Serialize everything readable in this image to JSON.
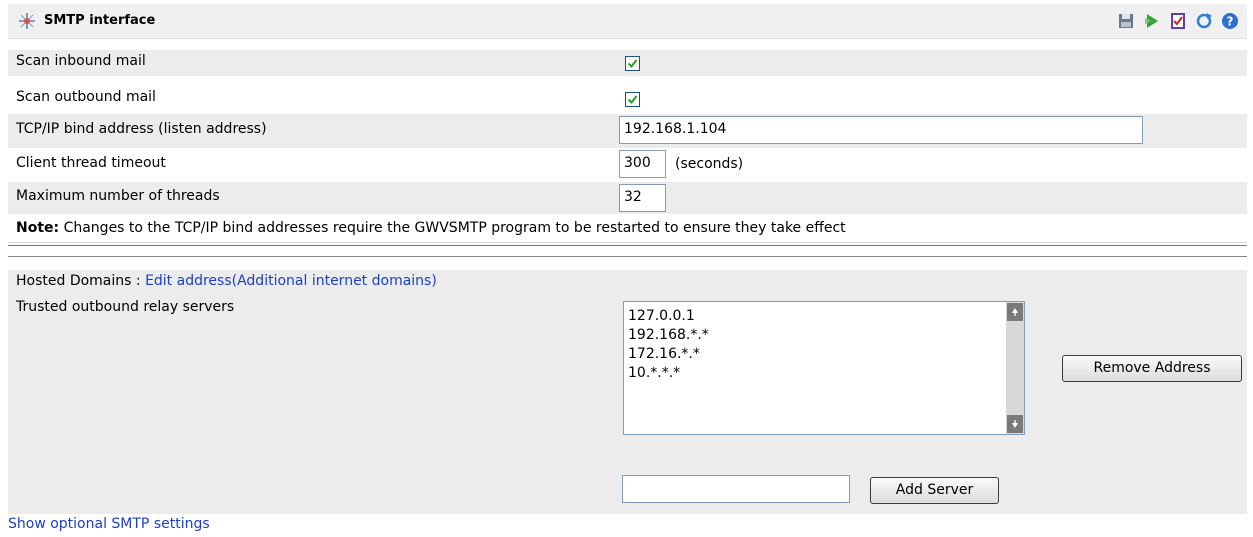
{
  "panel": {
    "title": "SMTP interface",
    "toolbar_icons": [
      "save-icon",
      "run-icon",
      "checklist-icon",
      "refresh-icon",
      "help-icon"
    ]
  },
  "settings": {
    "scan_inbound_label": "Scan inbound mail",
    "scan_inbound_checked": true,
    "scan_outbound_label": "Scan outbound mail",
    "scan_outbound_checked": true,
    "bind_address_label": "TCP/IP bind address (listen address)",
    "bind_address_value": "192.168.1.104",
    "thread_timeout_label": "Client thread timeout",
    "thread_timeout_value": "300",
    "thread_timeout_unit": "(seconds)",
    "max_threads_label": "Maximum number of threads",
    "max_threads_value": "32"
  },
  "note": {
    "prefix": "Note:",
    "text": " Changes to the TCP/IP bind addresses require the GWVSMTP program to be restarted to ensure they take effect"
  },
  "hosted": {
    "label": "Hosted Domains : ",
    "link": "Edit address(Additional internet domains)"
  },
  "relay": {
    "label": "Trusted outbound relay servers",
    "servers": [
      "127.0.0.1",
      "192.168.*.*",
      "172.16.*.*",
      "10.*.*.*"
    ],
    "remove_button": "Remove Address",
    "add_input_value": "",
    "add_button": "Add Server"
  },
  "footer": {
    "link": "Show optional SMTP settings"
  },
  "colors": {
    "link": "#1a3fc8",
    "row_alt": "#ececec",
    "titlebar": "#f0f0f0"
  }
}
